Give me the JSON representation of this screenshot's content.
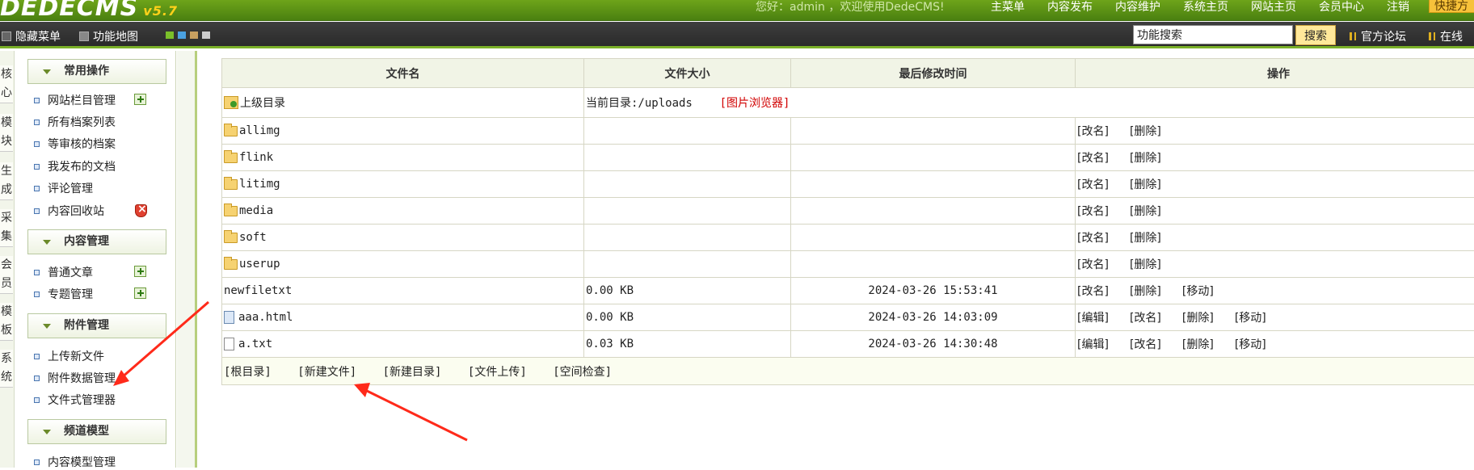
{
  "header": {
    "logo_text": "DEDECMS",
    "logo_version": "v5.7",
    "welcome": "您好：admin ，欢迎使用DedeCMS!",
    "nav": [
      "主菜单",
      "内容发布",
      "内容维护",
      "系统主页",
      "网站主页",
      "会员中心",
      "注销"
    ],
    "quick_button": "快捷方"
  },
  "toolbar": {
    "hide_menu": "隐藏菜单",
    "site_map": "功能地图",
    "search_value": "功能搜索",
    "search_button": "搜索",
    "forum_link": "官方论坛",
    "online_link": "在线",
    "swatch_colors": [
      "#7bbf2a",
      "#4aa0e0",
      "#c8a060",
      "#cccccc"
    ]
  },
  "vtabs": [
    "核心",
    "模块",
    "生成",
    "采集",
    "会员",
    "模板",
    "系统"
  ],
  "menu": {
    "groups": [
      {
        "title": "常用操作",
        "items": [
          "网站栏目管理",
          "所有档案列表",
          "等审核的档案",
          "我发布的文档",
          "评论管理",
          "内容回收站"
        ]
      },
      {
        "title": "内容管理",
        "items": [
          "普通文章",
          "专题管理"
        ]
      },
      {
        "title": "附件管理",
        "items": [
          "上传新文件",
          "附件数据管理",
          "文件式管理器"
        ]
      },
      {
        "title": "频道模型",
        "items": [
          "内容模型管理"
        ]
      }
    ]
  },
  "table": {
    "headers": [
      "文件名",
      "文件大小",
      "最后修改时间",
      "操作"
    ],
    "parent_dir_label": "上级目录",
    "current_dir": "当前目录:/uploads",
    "image_browser": "[图片浏览器]",
    "rows": [
      {
        "name": "allimg",
        "type": "folder",
        "size": "",
        "time": "",
        "ops": [
          "[改名]",
          "[删除]"
        ]
      },
      {
        "name": "flink",
        "type": "folder",
        "size": "",
        "time": "",
        "ops": [
          "[改名]",
          "[删除]"
        ]
      },
      {
        "name": "litimg",
        "type": "folder",
        "size": "",
        "time": "",
        "ops": [
          "[改名]",
          "[删除]"
        ]
      },
      {
        "name": "media",
        "type": "folder",
        "size": "",
        "time": "",
        "ops": [
          "[改名]",
          "[删除]"
        ]
      },
      {
        "name": "soft",
        "type": "folder",
        "size": "",
        "time": "",
        "ops": [
          "[改名]",
          "[删除]"
        ]
      },
      {
        "name": "userup",
        "type": "folder",
        "size": "",
        "time": "",
        "ops": [
          "[改名]",
          "[删除]"
        ]
      },
      {
        "name": "newfiletxt",
        "type": "none",
        "size": "0.00 KB",
        "time": "2024-03-26 15:53:41",
        "ops": [
          "[改名]",
          "[删除]",
          "[移动]"
        ]
      },
      {
        "name": "aaa.html",
        "type": "html",
        "size": "0.00 KB",
        "time": "2024-03-26 14:03:09",
        "ops": [
          "[编辑]",
          "[改名]",
          "[删除]",
          "[移动]"
        ]
      },
      {
        "name": "a.txt",
        "type": "txt",
        "size": "0.03 KB",
        "time": "2024-03-26 14:30:48",
        "ops": [
          "[编辑]",
          "[改名]",
          "[删除]",
          "[移动]"
        ]
      }
    ],
    "footer": [
      "[根目录]",
      "[新建文件]",
      "[新建目录]",
      "[文件上传]",
      "[空间检查]"
    ]
  },
  "annotation_color": "#ff2a1a"
}
